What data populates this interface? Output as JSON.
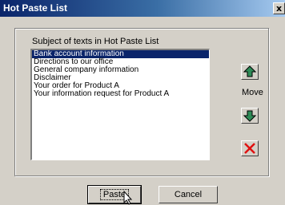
{
  "window": {
    "title": "Hot Paste List",
    "close_glyph": "x"
  },
  "group": {
    "label": "Subject of texts in Hot Paste List"
  },
  "list": {
    "items": [
      "Bank account information",
      "Directions to our office",
      "General company information",
      "Disclaimer",
      "Your order for Product A",
      "Your information request for Product A"
    ],
    "selected_index": 0
  },
  "side_controls": {
    "move_label": "Move",
    "up_icon": "arrow-up-icon",
    "down_icon": "arrow-down-icon",
    "delete_icon": "delete-x-icon"
  },
  "buttons": {
    "paste_label": "Paste",
    "cancel_label": "Cancel"
  },
  "colors": {
    "title_bar": "#0a246a",
    "selection": "#0a246a",
    "arrow_green": "#2e8b57",
    "delete_red": "#e01010"
  }
}
